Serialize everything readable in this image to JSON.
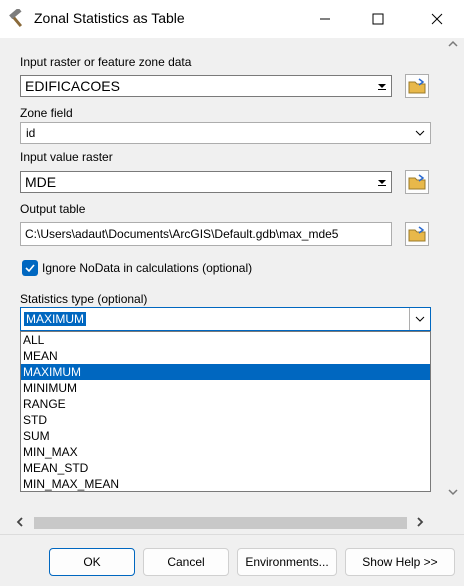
{
  "window": {
    "title": "Zonal Statistics as Table",
    "minimize_icon": "minimize-icon",
    "maximize_icon": "maximize-icon",
    "close_icon": "close-icon"
  },
  "form": {
    "zone_data": {
      "label": "Input raster or feature zone data",
      "value": "EDIFICACOES"
    },
    "zone_field": {
      "label": "Zone field",
      "value": "id"
    },
    "value_raster": {
      "label": "Input value raster",
      "value": "MDE"
    },
    "output_table": {
      "label": "Output table",
      "value": "C:\\Users\\adaut\\Documents\\ArcGIS\\Default.gdb\\max_mde5"
    },
    "ignore_nodata": {
      "label": "Ignore NoData in calculations (optional)",
      "checked": true
    },
    "statistics_type": {
      "label": "Statistics type (optional)",
      "value": "MAXIMUM",
      "options": [
        "ALL",
        "MEAN",
        "MAXIMUM",
        "MINIMUM",
        "RANGE",
        "STD",
        "SUM",
        "MIN_MAX",
        "MEAN_STD",
        "MIN_MAX_MEAN"
      ],
      "selected_index": 2
    }
  },
  "buttons": {
    "ok": "OK",
    "cancel": "Cancel",
    "environments": "Environments...",
    "show_help": "Show Help >>"
  },
  "colors": {
    "accent": "#0067c0",
    "folder_yellow": "#e8b84a"
  }
}
